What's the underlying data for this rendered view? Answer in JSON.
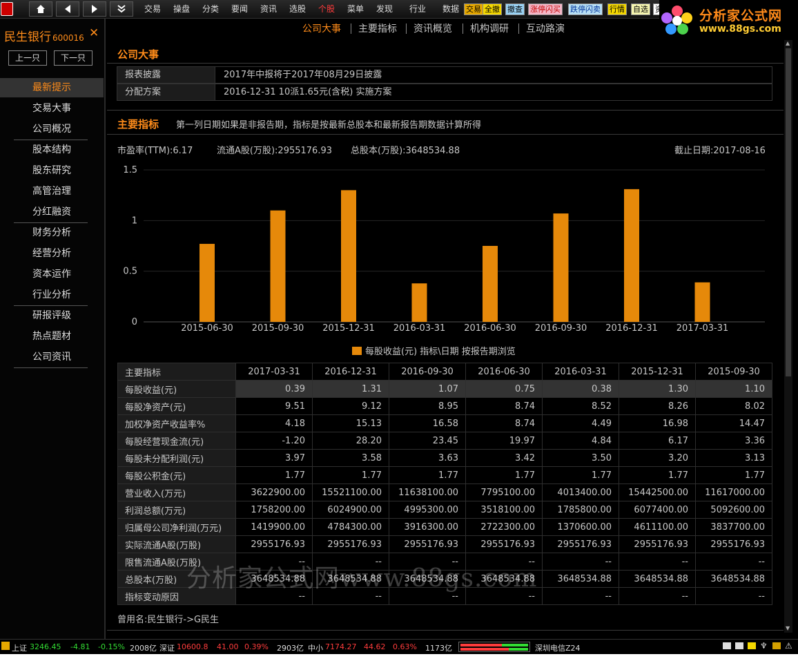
{
  "topbar": {
    "menus": [
      {
        "label": "交易",
        "active": false
      },
      {
        "label": "操盘",
        "active": false
      },
      {
        "label": "分类",
        "active": false
      },
      {
        "label": "要闻",
        "active": false
      },
      {
        "label": "资讯",
        "active": false
      },
      {
        "label": "选股",
        "active": false
      },
      {
        "label": "个股",
        "active": true
      },
      {
        "label": "菜单",
        "active": false
      },
      {
        "label": "发现",
        "active": false
      },
      {
        "label": "行业",
        "active": false
      },
      {
        "label": "数据",
        "active": false
      }
    ],
    "quick_buttons": [
      {
        "label": "交易",
        "bg": "#e6a800",
        "fg": "#000"
      },
      {
        "label": "全撤",
        "bg": "#f5d800",
        "fg": "#000"
      },
      {
        "label": "撤查",
        "bg": "#9ad3f5",
        "fg": "#000"
      },
      {
        "label": "涨停闪买",
        "bg": "#f5b8c8",
        "fg": "#c00000"
      },
      {
        "label": "跌停闪卖",
        "bg": "#b8e0f5",
        "fg": "#003399"
      },
      {
        "label": "行情",
        "bg": "#f5d800",
        "fg": "#000"
      },
      {
        "label": "自选",
        "bg": "#f5f5b0",
        "fg": "#000"
      },
      {
        "label": "资",
        "bg": "#ffffff",
        "fg": "#000"
      }
    ]
  },
  "watermark": {
    "top_line1": "分析家公式网",
    "top_line2": "www.88gs.com",
    "center": "分析家公式网www.88gs.com"
  },
  "stock": {
    "name": "民生银行",
    "code": "600016"
  },
  "left_panel": {
    "prev_label": "上一只",
    "next_label": "下一只",
    "groups": [
      [
        {
          "label": "最新提示",
          "selected": true
        },
        {
          "label": "交易大事"
        },
        {
          "label": "公司概况"
        }
      ],
      [
        {
          "label": "股本结构"
        },
        {
          "label": "股东研究"
        },
        {
          "label": "高管治理"
        },
        {
          "label": "分红融资"
        }
      ],
      [
        {
          "label": "财务分析"
        },
        {
          "label": "经营分析"
        },
        {
          "label": "资本运作"
        },
        {
          "label": "行业分析"
        }
      ],
      [
        {
          "label": "研报评级"
        },
        {
          "label": "热点题材"
        },
        {
          "label": "公司资讯"
        }
      ]
    ]
  },
  "tabs": [
    {
      "label": "公司大事",
      "active": true
    },
    {
      "label": "主要指标"
    },
    {
      "label": "资讯概览"
    },
    {
      "label": "机构调研"
    },
    {
      "label": "互动路演"
    }
  ],
  "company_events": {
    "title": "公司大事",
    "rows": [
      {
        "label": "报表披露",
        "value": "2017年中报将于2017年08月29日披露"
      },
      {
        "label": "分配方案",
        "value": "2016-12-31 10派1.65元(含税) 实施方案"
      }
    ]
  },
  "main_indicators": {
    "title": "主要指标",
    "note": "第一列日期如果是非报告期，指标是按最新总股本和最新报告期数据计算所得",
    "pe_ttm": "市盈率(TTM):6.17",
    "float_a": "流通A股(万股):2955176.93",
    "total_shares": "总股本(万股):3648534.88",
    "as_of": "截止日期:2017-08-16"
  },
  "chart_data": {
    "type": "bar",
    "categories": [
      "2015-06-30",
      "2015-09-30",
      "2015-12-31",
      "2016-03-31",
      "2016-06-30",
      "2016-09-30",
      "2016-12-31",
      "2017-03-31"
    ],
    "values": [
      0.77,
      1.1,
      1.3,
      0.38,
      0.75,
      1.07,
      1.31,
      0.39
    ],
    "ylim": [
      0,
      1.5
    ],
    "yticks": [
      "0",
      "0.5",
      "1",
      "1.5"
    ],
    "legend": "每股收益(元) 指标\\日期 按报告期浏览",
    "bar_color": "#e6890a",
    "grid": true
  },
  "table": {
    "header_label": "主要指标",
    "columns": [
      "2017-03-31",
      "2016-12-31",
      "2016-09-30",
      "2016-06-30",
      "2016-03-31",
      "2015-12-31",
      "2015-09-30"
    ],
    "rows": [
      {
        "label": "每股收益(元)",
        "values": [
          "0.39",
          "1.31",
          "1.07",
          "0.75",
          "0.38",
          "1.30",
          "1.10"
        ],
        "highlight": true
      },
      {
        "label": "每股净资产(元)",
        "values": [
          "9.51",
          "9.12",
          "8.95",
          "8.74",
          "8.52",
          "8.26",
          "8.02"
        ]
      },
      {
        "label": "加权净资产收益率%",
        "values": [
          "4.18",
          "15.13",
          "16.58",
          "8.74",
          "4.49",
          "16.98",
          "14.47"
        ]
      },
      {
        "label": "每股经营现金流(元)",
        "values": [
          "-1.20",
          "28.20",
          "23.45",
          "19.97",
          "4.84",
          "6.17",
          "3.36"
        ]
      },
      {
        "label": "每股未分配利润(元)",
        "values": [
          "3.97",
          "3.58",
          "3.63",
          "3.42",
          "3.50",
          "3.20",
          "3.13"
        ]
      },
      {
        "label": "每股公积金(元)",
        "values": [
          "1.77",
          "1.77",
          "1.77",
          "1.77",
          "1.77",
          "1.77",
          "1.77"
        ]
      },
      {
        "label": "营业收入(万元)",
        "values": [
          "3622900.00",
          "15521100.00",
          "11638100.00",
          "7795100.00",
          "4013400.00",
          "15442500.00",
          "11617000.00"
        ]
      },
      {
        "label": "利润总额(万元)",
        "values": [
          "1758200.00",
          "6024900.00",
          "4995300.00",
          "3518100.00",
          "1785800.00",
          "6077400.00",
          "5092600.00"
        ]
      },
      {
        "label": "归属母公司净利润(万元)",
        "values": [
          "1419900.00",
          "4784300.00",
          "3916300.00",
          "2722300.00",
          "1370600.00",
          "4611100.00",
          "3837700.00"
        ]
      },
      {
        "label": "实际流通A股(万股)",
        "values": [
          "2955176.93",
          "2955176.93",
          "2955176.93",
          "2955176.93",
          "2955176.93",
          "2955176.93",
          "2955176.93"
        ]
      },
      {
        "label": "限售流通A股(万股)",
        "values": [
          "--",
          "--",
          "--",
          "--",
          "--",
          "--",
          "--"
        ]
      },
      {
        "label": "总股本(万股)",
        "values": [
          "3648534.88",
          "3648534.88",
          "3648534.88",
          "3648534.88",
          "3648534.88",
          "3648534.88",
          "3648534.88"
        ]
      },
      {
        "label": "指标变动原因",
        "values": [
          "--",
          "--",
          "--",
          "--",
          "--",
          "--",
          "--"
        ]
      }
    ]
  },
  "former_name": "曾用名:民生银行->G民生",
  "statusbar": {
    "sh_name": "上证",
    "sh_index": "3246.45",
    "sh_change": "-4.81",
    "sh_pct": "-0.15%",
    "sh_amount": "2008亿",
    "sz_name": "深证",
    "sz_index": "10600.8",
    "sz_change": "41.00",
    "sz_pct": "0.39%",
    "sz_amount": "2903亿",
    "zx_name": "中小",
    "zx_index": "7174.27",
    "zx_change": "44.62",
    "zx_pct": "0.63%",
    "zx_amount": "1173亿",
    "server": "深圳电信Z24"
  }
}
